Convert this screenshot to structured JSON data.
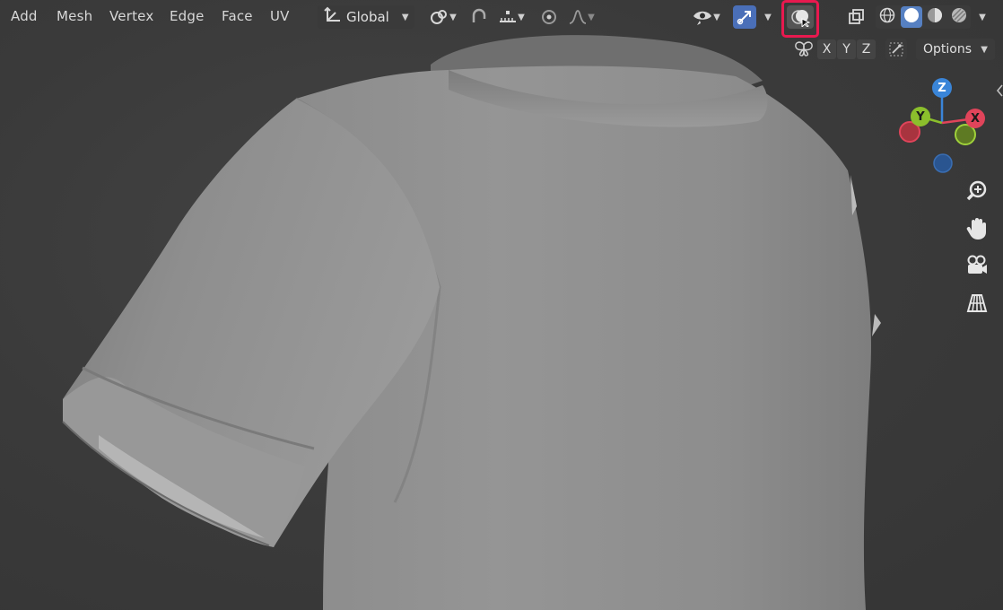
{
  "menu": {
    "items": [
      "Add",
      "Mesh",
      "Vertex",
      "Edge",
      "Face",
      "UV"
    ]
  },
  "header": {
    "transform_orientation": "Global",
    "options_label": "Options",
    "axis_labels": [
      "X",
      "Y",
      "Z"
    ]
  },
  "gizmo": {
    "z_label": "Z",
    "y_label": "Y",
    "x_label": "X"
  },
  "icons": {
    "pivot": "pivot-point-icon",
    "transform": "transform-axes-icon",
    "snap": "snap-icon",
    "snap_target": "snap-increment-icon",
    "proportional": "proportional-editing-icon",
    "falloff": "falloff-curve-icon",
    "visibility": "eye-icon",
    "gizmo_toggle": "gizmo-icon",
    "overlay": "overlay-icon",
    "xray": "xray-icon",
    "wireframe": "wireframe-shading-icon",
    "solid": "solid-shading-icon",
    "material": "material-shading-icon",
    "rendered": "rendered-shading-icon",
    "mirror": "mirror-butterfly-icon",
    "auto_merge": "auto-merge-icon",
    "zoom": "zoom-icon",
    "hand": "pan-hand-icon",
    "camera": "camera-icon",
    "grid": "perspective-grid-icon"
  },
  "colors": {
    "highlight": "#e8194f",
    "active_button": "#4a6fb8",
    "axis_x": "#e0445a",
    "axis_y": "#8bbf2c",
    "axis_z": "#3a85d8"
  }
}
